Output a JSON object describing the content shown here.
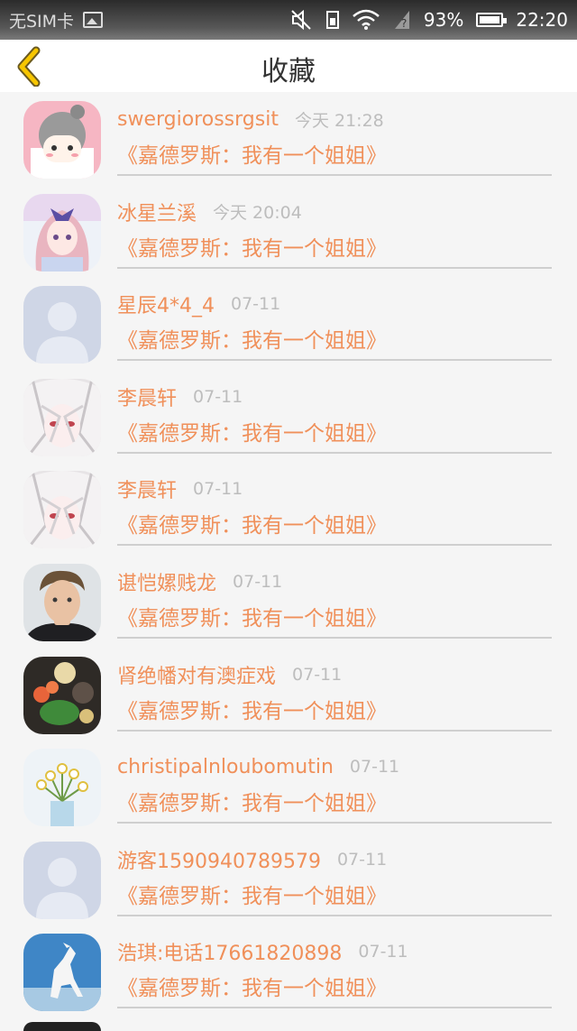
{
  "status_bar": {
    "carrier": "无SIM卡",
    "battery_percent": "93%",
    "time": "22:20",
    "icons": [
      "image-icon",
      "mute-icon",
      "sim-icon",
      "wifi-icon",
      "signal-icon",
      "battery-icon"
    ]
  },
  "header": {
    "title": "收藏",
    "back_icon": "chevron-left-icon"
  },
  "colors": {
    "accent": "#f0905a",
    "time_text": "#bdbdbd",
    "back_icon": "#f5c400"
  },
  "items": [
    {
      "name": "swergiorossrgsit",
      "time": "今天 21:28",
      "book": "《嘉德罗斯：我有一个姐姐》",
      "avatar": "cartoon-girl-avatar"
    },
    {
      "name": "冰星兰溪",
      "time": "今天 20:04",
      "book": "《嘉德罗斯：我有一个姐姐》",
      "avatar": "anime-girl-avatar"
    },
    {
      "name": "星辰4*4_4",
      "time": "07-11",
      "book": "《嘉德罗斯：我有一个姐姐》",
      "avatar": "default-avatar"
    },
    {
      "name": "李晨轩",
      "time": "07-11",
      "book": "《嘉德罗斯：我有一个姐姐》",
      "avatar": "anime-white-hair-avatar"
    },
    {
      "name": "李晨轩",
      "time": "07-11",
      "book": "《嘉德罗斯：我有一个姐姐》",
      "avatar": "anime-white-hair-avatar"
    },
    {
      "name": "谌恺嫘贱龙",
      "time": "07-11",
      "book": "《嘉德罗斯：我有一个姐姐》",
      "avatar": "man-photo-avatar"
    },
    {
      "name": "肾绝幡对有澳症戏",
      "time": "07-11",
      "book": "《嘉德罗斯：我有一个姐姐》",
      "avatar": "food-photo-avatar"
    },
    {
      "name": "christipalnloubomutin",
      "time": "07-11",
      "book": "《嘉德罗斯：我有一个姐姐》",
      "avatar": "flowers-photo-avatar"
    },
    {
      "name": "游客1590940789579",
      "time": "07-11",
      "book": "《嘉德罗斯：我有一个姐姐》",
      "avatar": "default-avatar"
    },
    {
      "name": "浩琪:电话17661820898",
      "time": "07-11",
      "book": "《嘉德罗斯：我有一个姐姐》",
      "avatar": "horse-photo-avatar"
    }
  ]
}
